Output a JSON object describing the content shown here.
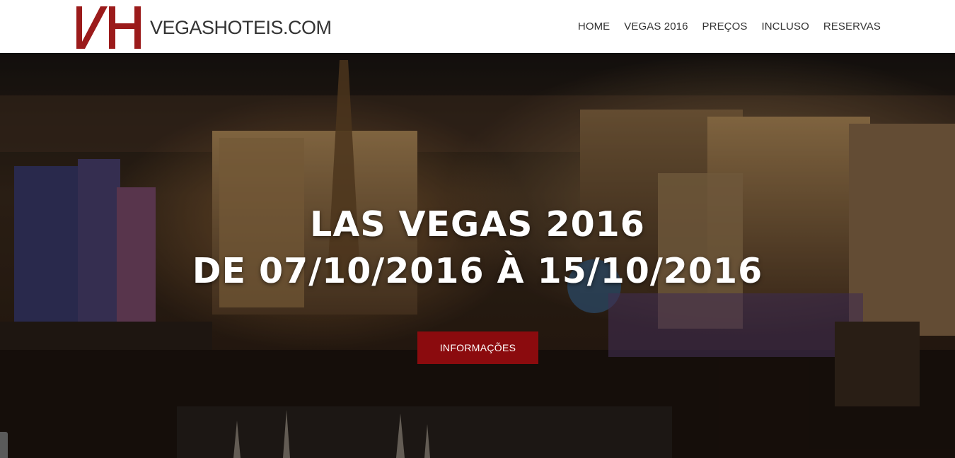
{
  "header": {
    "logo_text": "VEGASHOTEIS.COM",
    "logo_mark": "VH",
    "nav": [
      {
        "label": "HOME"
      },
      {
        "label": "VEGAS 2016"
      },
      {
        "label": "PREÇOS"
      },
      {
        "label": "INCLUSO"
      },
      {
        "label": "RESERVAS"
      }
    ]
  },
  "hero": {
    "title_line1": "LAS VEGAS 2016",
    "title_line2": "DE 07/10/2016 À 15/10/2016",
    "cta_label": "INFORMAÇÕES",
    "background": "las-vegas-strip-night-photo"
  },
  "colors": {
    "brand_red": "#8b0b0e",
    "logo_red": "#9b1b1b",
    "nav_text": "#333333"
  }
}
